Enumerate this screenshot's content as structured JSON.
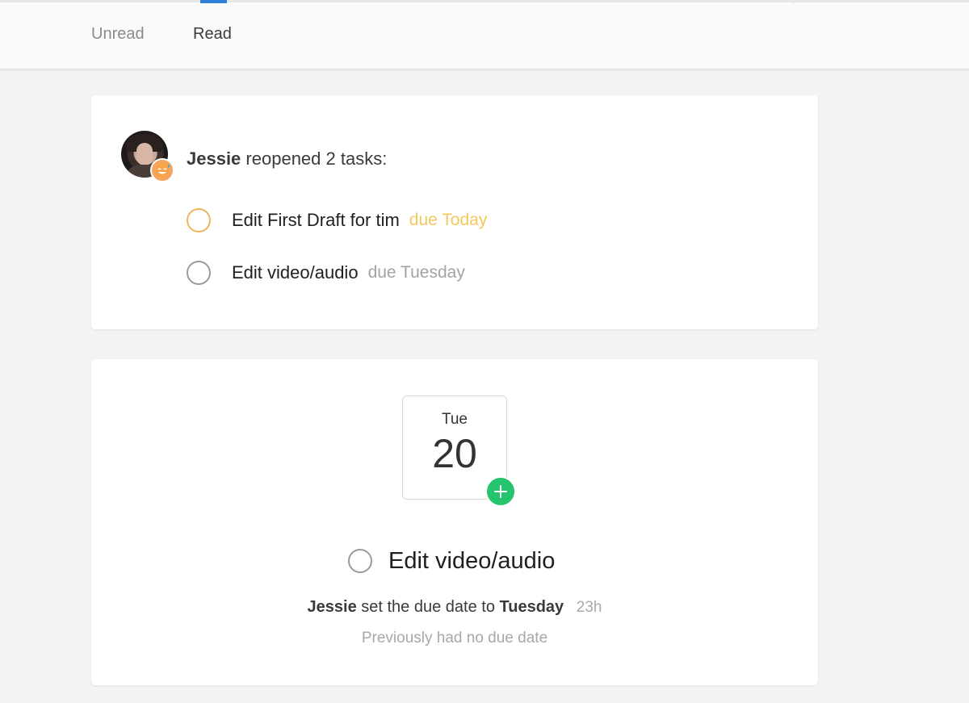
{
  "tabs": {
    "unread": "Unread",
    "read": "Read"
  },
  "activity1": {
    "actor": "Jessie",
    "action": "reopened 2 tasks:",
    "tasks": [
      {
        "name": "Edit First Draft for tim",
        "due": "due Today",
        "status": "due-today"
      },
      {
        "name": "Edit video/audio",
        "due": "due Tuesday",
        "status": "due-later"
      }
    ]
  },
  "activity2": {
    "date_weekday": "Tue",
    "date_day": "20",
    "task_name": "Edit video/audio",
    "actor": "Jessie",
    "action": "set the due date to",
    "new_due": "Tuesday",
    "time_ago": "23h",
    "previous_note": "Previously had no due date"
  },
  "colors": {
    "tab_indicator": "#2f80d8",
    "due_today": "#f5c85a",
    "add_badge": "#26c46d"
  }
}
